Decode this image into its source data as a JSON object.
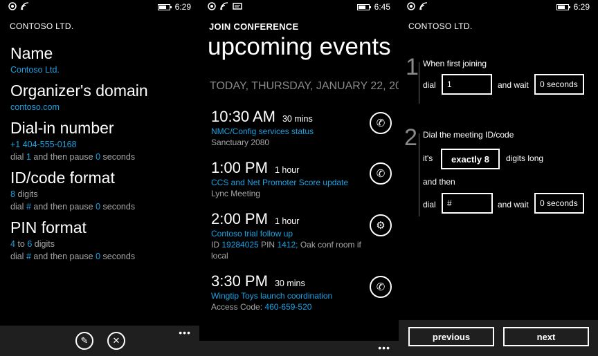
{
  "screen1": {
    "time": "6:29",
    "app_title": "CONTOSO LTD.",
    "name_label": "Name",
    "name_value": "Contoso Ltd.",
    "domain_label": "Organizer's domain",
    "domain_value": "contoso.com",
    "dialin_label": "Dial-in number",
    "dialin_number": "+1 404-555-0168",
    "dialin_pre": "dial",
    "dialin_digit": "1",
    "dialin_mid": "and then pause",
    "dialin_pause": "0",
    "dialin_post": "seconds",
    "idcode_label": "ID/code format",
    "idcode_digits": "8",
    "idcode_digits_word": "digits",
    "idcode_pre": "dial",
    "idcode_key": "#",
    "idcode_mid": "and then pause",
    "idcode_pause": "0",
    "idcode_post": "seconds",
    "pin_label": "PIN format",
    "pin_min": "4",
    "pin_to": "to",
    "pin_max": "6",
    "pin_digits_word": "digits",
    "pin_pre": "dial",
    "pin_key": "#",
    "pin_mid": "and then pause",
    "pin_pause": "0",
    "pin_post": "seconds",
    "edit_icon": "✎",
    "close_icon": "✕",
    "more": "•••"
  },
  "screen2": {
    "time": "6:45",
    "app_title": "JOIN CONFERENCE",
    "page_title": "upcoming events",
    "date_header": "TODAY, THURSDAY, JANUARY 22, 20",
    "events": [
      {
        "time": "10:30 AM",
        "duration": "30 mins",
        "title": "NMC/Config services status",
        "location": "Sanctuary 2080"
      },
      {
        "time": "1:00 PM",
        "duration": "1 hour",
        "title": "CCS and Net Promoter Score update",
        "location": "Lync Meeting"
      },
      {
        "time": "2:00 PM",
        "duration": "1 hour",
        "title": "Contoso trial follow up",
        "loc_id_label": "ID",
        "loc_id": "19284025",
        "loc_pin_label": "PIN",
        "loc_pin": "1412;",
        "loc_rest": "Oak conf room if local"
      },
      {
        "time": "3:30 PM",
        "duration": "30 mins",
        "title": "Wingtip Toys launch coordination",
        "loc_code_label": "Access Code:",
        "loc_code": "460-659-520"
      }
    ],
    "phone_icon": "✆",
    "settings_icon": "⚙",
    "more": "•••"
  },
  "screen3": {
    "time": "6:29",
    "app_title": "CONTOSO LTD.",
    "step1_num": "1",
    "step1_title": "When first joining",
    "step1_dial_label": "dial",
    "step1_dial_value": "1",
    "step1_wait_label": "and wait",
    "step1_wait_value": "0 seconds",
    "step2_num": "2",
    "step2_title": "Dial the meeting ID/code",
    "step2_its": "it's",
    "step2_length": "exactly 8",
    "step2_digits_long": "digits long",
    "step2_and_then": "and then",
    "step2_dial_label": "dial",
    "step2_dial_value": "#",
    "step2_wait_label": "and wait",
    "step2_wait_value": "0 seconds",
    "previous_label": "previous",
    "next_label": "next"
  }
}
